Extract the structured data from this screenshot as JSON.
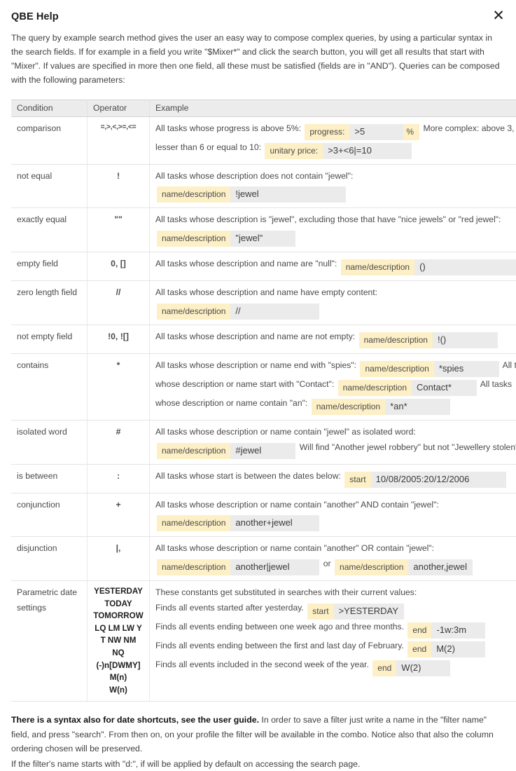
{
  "dialog": {
    "title": "QBE Help",
    "close_label": "✕",
    "intro": "The query by example search method gives the user an easy way to compose complex queries, by using a particular syntax in the search fields. If for example in a field you write \"$Mixer*\" and click the search button, you will get all results that start with \"Mixer\". If values are specified in more then one field, all these must be satisfied (fields are in \"AND\"). Queries can be composed with the following parameters:"
  },
  "table": {
    "headers": {
      "condition": "Condition",
      "operator": "Operator",
      "example": "Example"
    },
    "rows": [
      {
        "condition": "comparison",
        "operator": "=,>,<,>=,<=",
        "text1": "All tasks whose progress is above 5%:",
        "field1_label": "progress:",
        "field1_value": ">5",
        "field1_suffix": "%",
        "text2": "More complex: above 3, lesser than 6 or equal to 10:",
        "field2_label": "unitary price:",
        "field2_value": ">3+<6|=10"
      },
      {
        "condition": "not equal",
        "operator": "!",
        "text1": "All tasks whose description does not contain \"jewel\":",
        "field1_label": "name/description",
        "field1_value": "!jewel"
      },
      {
        "condition": "exactly equal",
        "operator": "\"\"",
        "text1": "All tasks whose description is \"jewel\", excluding those that have \"nice jewels\" or \"red jewel\":",
        "field1_label": "name/description",
        "field1_value": "\"jewel\""
      },
      {
        "condition": "empty field",
        "operator": "0, []",
        "text1": "All tasks whose description and name are \"null\":",
        "field1_label": "name/description",
        "field1_value": "()"
      },
      {
        "condition": "zero length field",
        "operator": "//",
        "text1": "All tasks whose description and name have empty content:",
        "field1_label": "name/description",
        "field1_value": "//"
      },
      {
        "condition": "not empty field",
        "operator": "!0, ![]",
        "text1": "All tasks whose description and name are not empty:",
        "field1_label": "name/description",
        "field1_value": "!()"
      },
      {
        "condition": "contains",
        "operator": "*",
        "text1": "All tasks whose description or name end with \"spies\":",
        "field1_label": "name/description",
        "field1_value": "*spies",
        "text2": "All tasks whose description or name start with \"Contact\":",
        "field2_label": "name/description",
        "field2_value": "Contact*",
        "text3": "All tasks whose description or name contain \"an\":",
        "field3_label": "name/description",
        "field3_value": "*an*"
      },
      {
        "condition": "isolated word",
        "operator": "#",
        "text1": "All tasks whose description or name contain \"jewel\" as isolated word:",
        "field1_label": "name/description",
        "field1_value": "#jewel",
        "text2": "Will find \"Another jewel robbery\" but not \"Jewellery stolen\""
      },
      {
        "condition": "is between",
        "operator": ":",
        "text1": "All tasks whose start is between the dates below:",
        "field1_label": "start",
        "field1_value": "10/08/2005:20/12/2006"
      },
      {
        "condition": "conjunction",
        "operator": "+",
        "text1": "All tasks whose description or name contain \"another\" AND contain \"jewel\":",
        "field1_label": "name/description",
        "field1_value": "another+jewel"
      },
      {
        "condition": "disjunction",
        "operator": "|,",
        "text1": "All tasks whose description or name contain \"another\" OR contain \"jewel\":",
        "field1_label": "name/description",
        "field1_value": "another|jewel",
        "text2": "or",
        "field2_label": "name/description",
        "field2_value": "another,jewel"
      }
    ],
    "parametric": {
      "condition": "Parametric date settings",
      "constants": [
        "YESTERDAY",
        "TODAY",
        "TOMORROW",
        "LQ LM LW Y",
        "T NW NM",
        "NQ",
        "(-)n[DWMY]",
        "M(n)",
        "W(n)"
      ],
      "intro": "These constants get substituted in searches with their current values:",
      "lines": [
        {
          "text": "Finds all events started after yesterday.",
          "field_label": "start",
          "field_value": ">YESTERDAY"
        },
        {
          "text": "Finds all events ending between one week ago and three months.",
          "field_label": "end",
          "field_value": "-1w:3m"
        },
        {
          "text": "Finds all events ending between the first and last day of February.",
          "field_label": "end",
          "field_value": "M(2)"
        },
        {
          "text": "Finds all events included in the second week of the year.",
          "field_label": "end",
          "field_value": "W(2)"
        }
      ]
    }
  },
  "footer": {
    "bold_lead": "There is a syntax also for date shortcuts, see the user guide.",
    "rest": " In order to save a filter just write a name in the \"filter name\" field, and press \"search\". From then on, on your profile the filter will be available in the combo. Notice also that also the column ordering chosen will be preserved.",
    "line2": "If the filter's name starts with \"d:\", if will be applied by default on accessing the search page."
  }
}
